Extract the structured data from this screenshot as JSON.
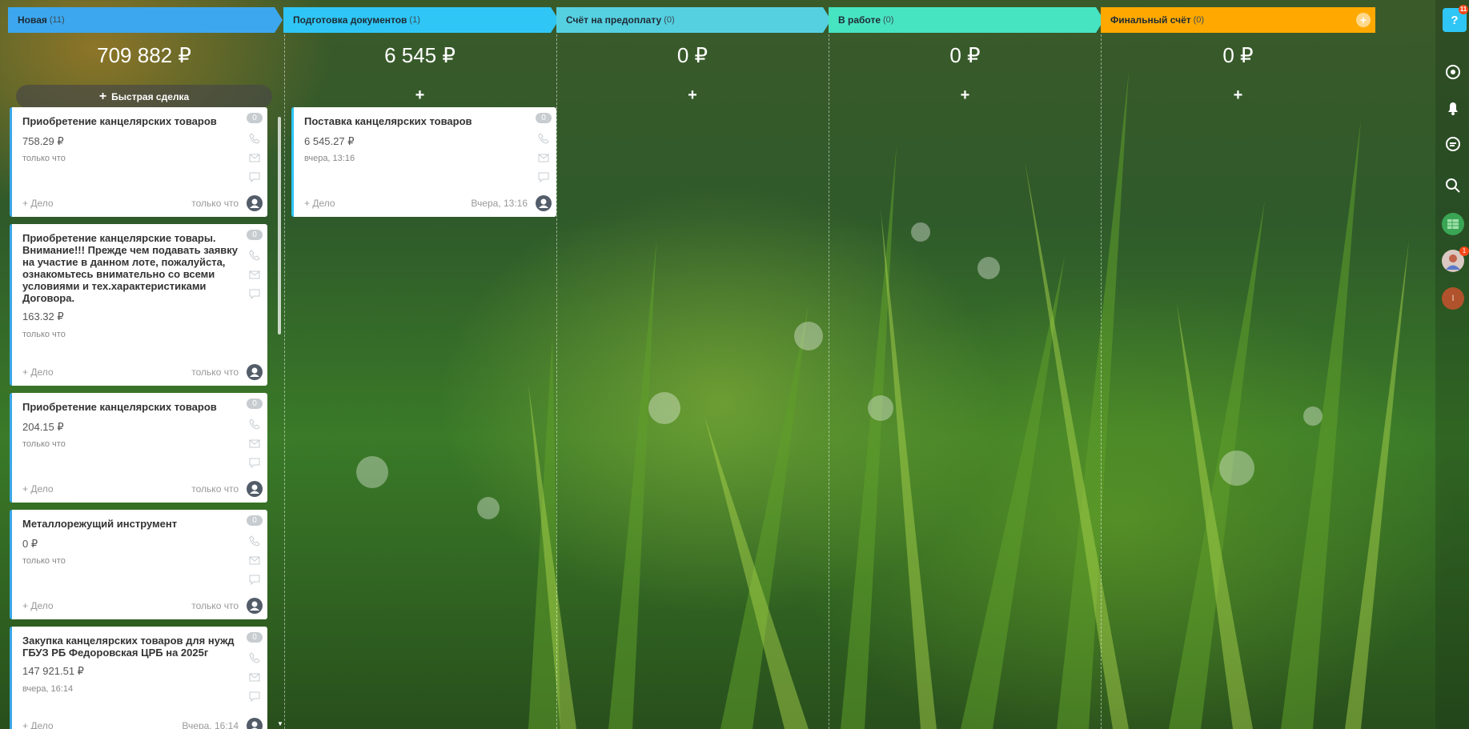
{
  "columns": [
    {
      "title": "Новая",
      "count": "(11)",
      "sum": "709 882 ₽",
      "color": "#3ca7ee"
    },
    {
      "title": "Подготовка документов",
      "count": "(1)",
      "sum": "6 545 ₽",
      "color": "#2fc6f6"
    },
    {
      "title": "Счёт на предоплату",
      "count": "(0)",
      "sum": "0 ₽",
      "color": "#55d0e0"
    },
    {
      "title": "В работе",
      "count": "(0)",
      "sum": "0 ₽",
      "color": "#47e4c2"
    },
    {
      "title": "Финальный счёт",
      "count": "(0)",
      "sum": "0 ₽",
      "color": "#ffa900"
    }
  ],
  "quick_deal": {
    "plus": "+",
    "label": "Быстрая сделка"
  },
  "add_plus": "+",
  "cards_new": [
    {
      "title": "Приобретение канцелярских товаров",
      "amount": "758.29 ₽",
      "time": "только что",
      "badge": "0",
      "task": "+ Дело",
      "foot_time": "только что"
    },
    {
      "title": "Приобретение канцелярские товары. Внимание!!! Прежде чем подавать заявку на участие в данном лоте, пожалуйста, ознакомьтесь внимательно со всеми условиями и тех.характеристиками Договора.",
      "amount": "163.32 ₽",
      "time": "только что",
      "badge": "0",
      "task": "+ Дело",
      "foot_time": "только что"
    },
    {
      "title": "Приобретение канцелярских товаров",
      "amount": "204.15 ₽",
      "time": "только что",
      "badge": "0",
      "task": "+ Дело",
      "foot_time": "только что"
    },
    {
      "title": "Металлорежущий инструмент",
      "amount": "0 ₽",
      "time": "только что",
      "badge": "0",
      "task": "+ Дело",
      "foot_time": "только что"
    },
    {
      "title": "Закупка канцелярских товаров для нужд ГБУЗ РБ Федоровская ЦРБ на 2025г",
      "amount": "147 921.51 ₽",
      "time": "вчера, 16:14",
      "badge": "0",
      "task": "+ Дело",
      "foot_time": "Вчера, 16:14"
    }
  ],
  "cards_docs": [
    {
      "title": "Поставка канцелярских товаров",
      "amount": "6 545.27 ₽",
      "time": "вчера, 13:16",
      "badge": "0",
      "task": "+ Дело",
      "foot_time": "Вчера, 13:16"
    }
  ],
  "rail": {
    "help": "?",
    "help_badge": "11",
    "avatar_badge": "1",
    "user_initial": "I"
  }
}
